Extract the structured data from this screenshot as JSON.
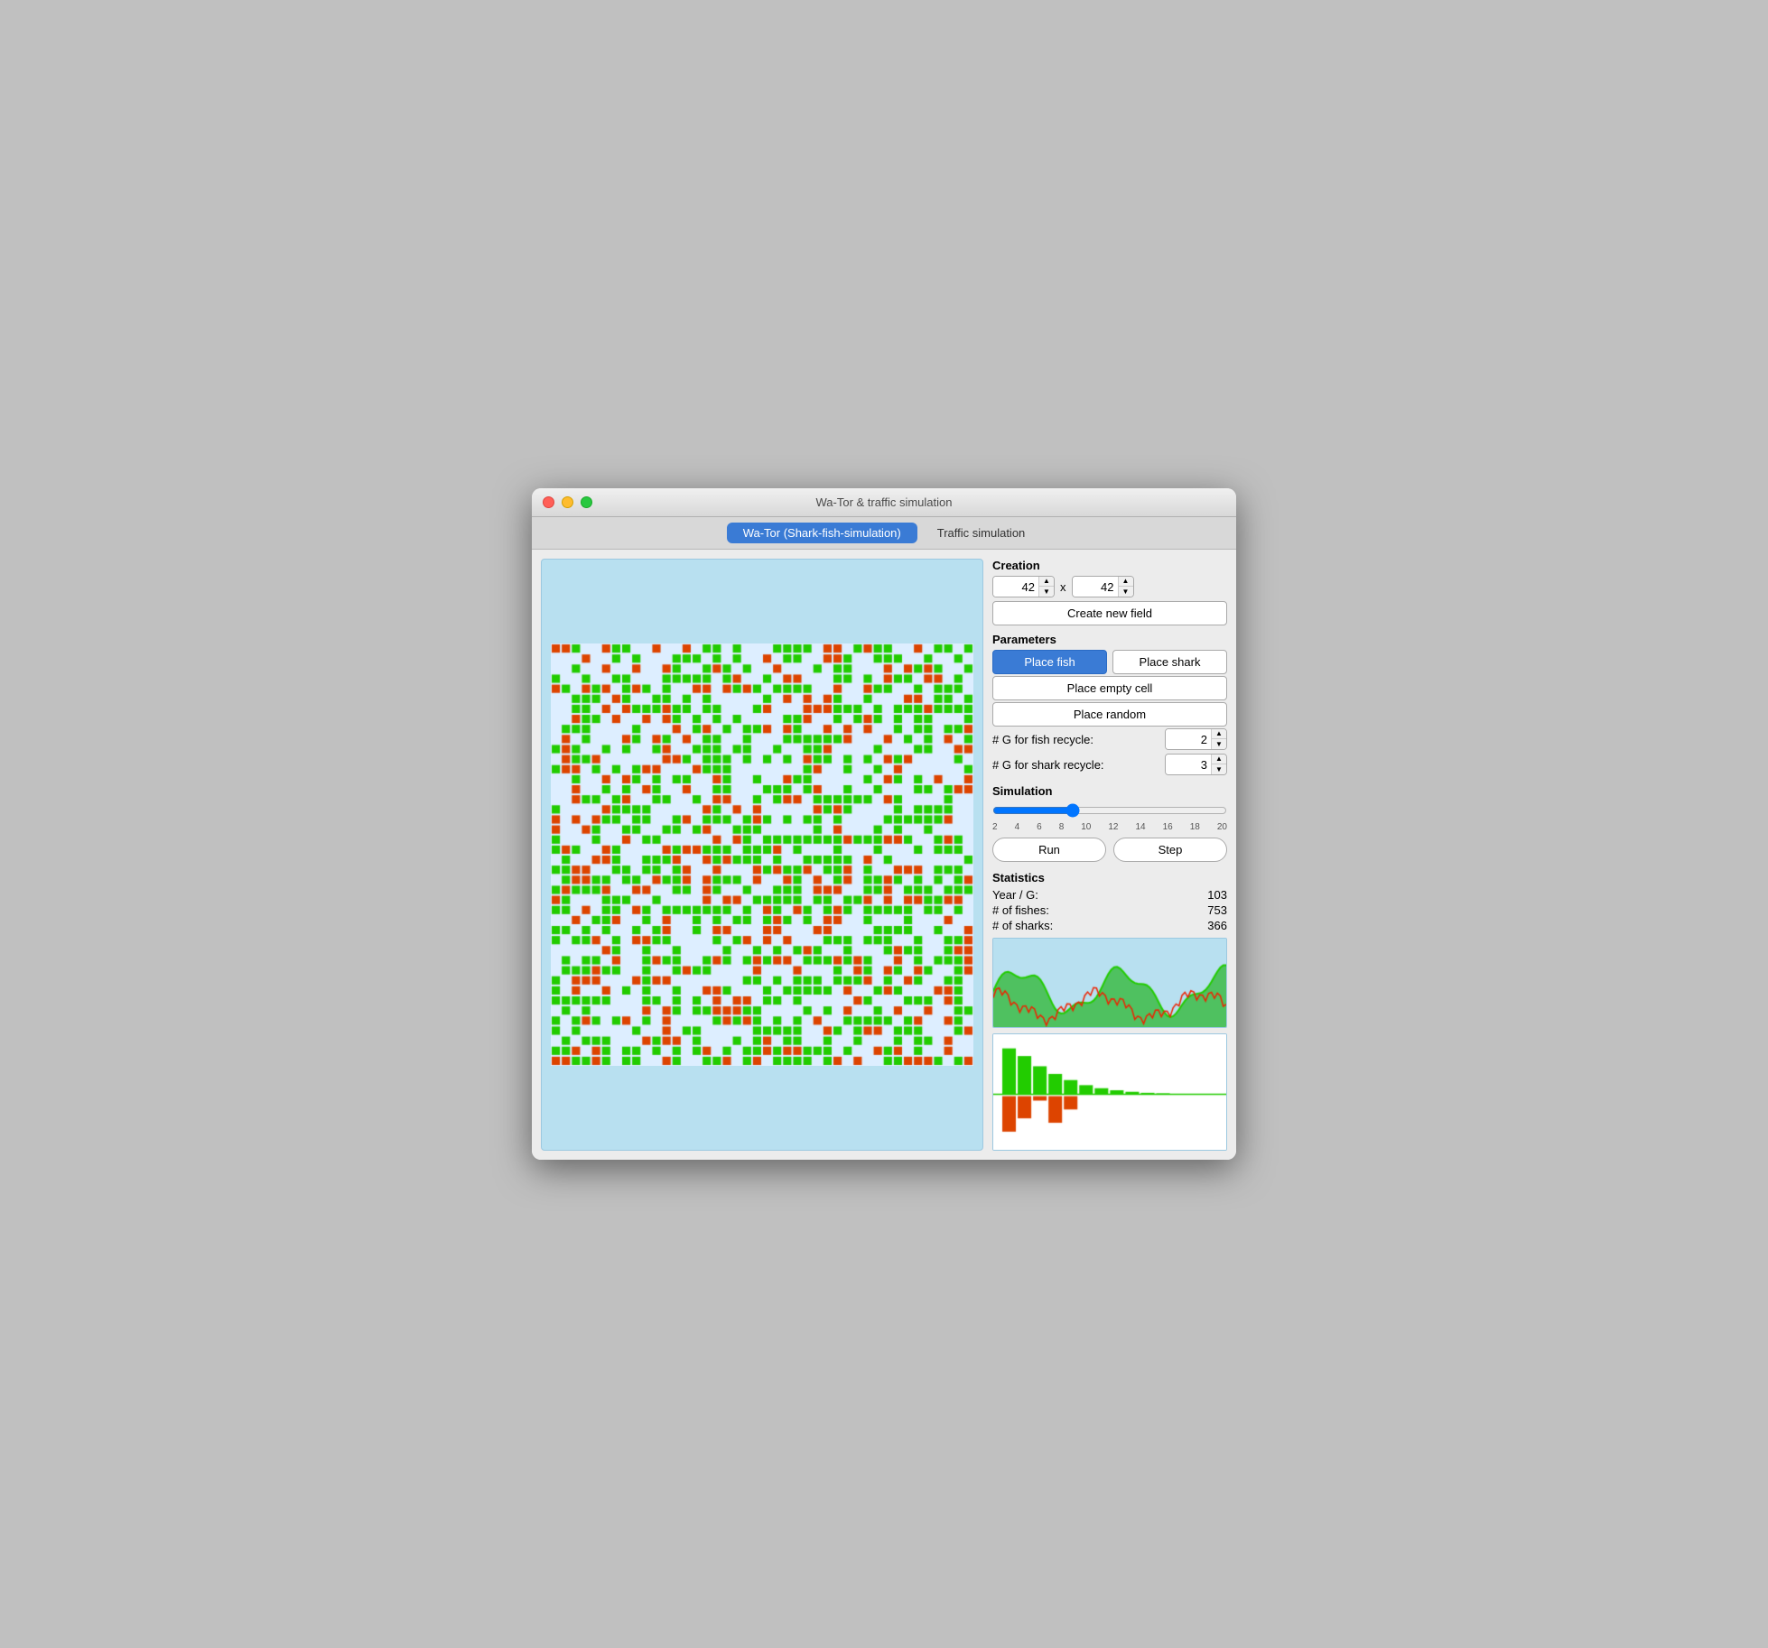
{
  "window": {
    "title": "Wa-Tor & traffic simulation"
  },
  "tabs": [
    {
      "id": "wator",
      "label": "Wa-Tor (Shark-fish-simulation)",
      "active": true
    },
    {
      "id": "traffic",
      "label": "Traffic simulation",
      "active": false
    }
  ],
  "creation": {
    "title": "Creation",
    "width_value": "42",
    "height_value": "42",
    "separator": "x",
    "create_button": "Create new field"
  },
  "parameters": {
    "title": "Parameters",
    "place_fish": "Place fish",
    "place_shark": "Place shark",
    "place_empty": "Place empty cell",
    "place_random": "Place random",
    "fish_recycle_label": "# G for fish recycle:",
    "fish_recycle_value": "2",
    "shark_recycle_label": "# G for shark recycle:",
    "shark_recycle_value": "3"
  },
  "simulation": {
    "title": "Simulation",
    "slider_value": 8,
    "slider_min": 2,
    "slider_max": 20,
    "slider_labels": [
      "2",
      "4",
      "6",
      "8",
      "10",
      "12",
      "14",
      "16",
      "18",
      "20"
    ],
    "run_button": "Run",
    "step_button": "Step"
  },
  "statistics": {
    "title": "Statistics",
    "year_label": "Year / G:",
    "year_value": "103",
    "fishes_label": "# of fishes:",
    "fishes_value": "753",
    "sharks_label": "# of sharks:",
    "sharks_value": "366"
  },
  "colors": {
    "fish": "#22cc00",
    "shark": "#dd4400",
    "empty": "#ddeeff",
    "background": "#b8e0f0",
    "tab_active": "#3a7bd5"
  }
}
